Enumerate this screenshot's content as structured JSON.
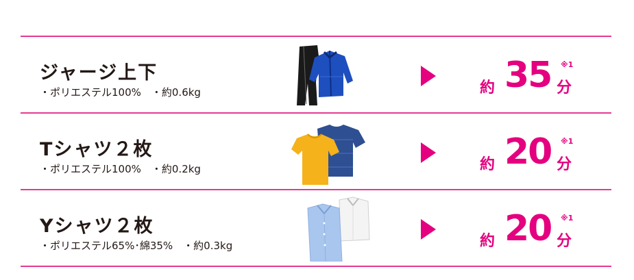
{
  "colors": {
    "accent": "#e4007f",
    "rule": "#e5398f",
    "text": "#231815"
  },
  "rows": [
    {
      "title": "ジャージ上下",
      "spec": "・ポリエステル100%　・約0.6kg",
      "image": "jersey-image",
      "prefix": "約",
      "value": "35",
      "unit": "分",
      "note": "※1"
    },
    {
      "title": "Tシャツ２枚",
      "spec": "・ポリエステル100%　・約0.2kg",
      "image": "tshirts-image",
      "prefix": "約",
      "value": "20",
      "unit": "分",
      "note": "※1"
    },
    {
      "title": "Yシャツ２枚",
      "spec": "・ポリエステル65%･綿35%　・約0.3kg",
      "image": "dress-shirts-image",
      "prefix": "約",
      "value": "20",
      "unit": "分",
      "note": "※1"
    }
  ]
}
